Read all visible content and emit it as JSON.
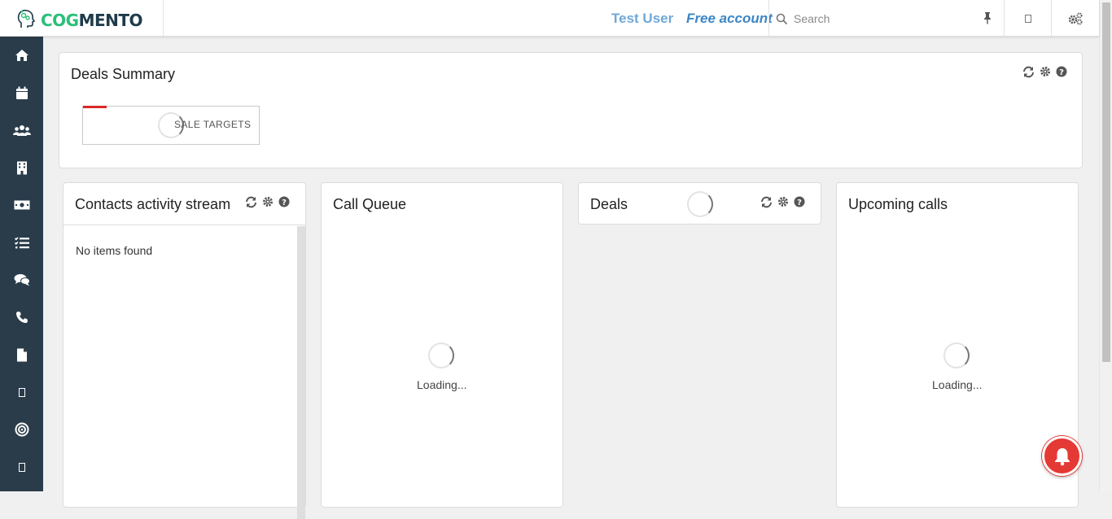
{
  "header": {
    "logo": {
      "part1": "COG",
      "part2": "MENTO"
    },
    "user_name": "Test User",
    "account_type": "Free account",
    "search": {
      "placeholder": "Search",
      "value": ""
    },
    "icons": [
      "search-icon",
      "pin-icon",
      "settings-icon"
    ]
  },
  "sidebar": {
    "items": [
      {
        "name": "home",
        "icon": "home-icon"
      },
      {
        "name": "calendar",
        "icon": "calendar-icon"
      },
      {
        "name": "contacts",
        "icon": "users-icon"
      },
      {
        "name": "companies",
        "icon": "building-icon"
      },
      {
        "name": "deals",
        "icon": "money-icon"
      },
      {
        "name": "tasks",
        "icon": "tasks-icon"
      },
      {
        "name": "cases",
        "icon": "chat-icon"
      },
      {
        "name": "calls",
        "icon": "phone-icon"
      },
      {
        "name": "documents",
        "icon": "document-icon"
      },
      {
        "name": "unknown-1",
        "icon": "box-icon"
      },
      {
        "name": "campaigns",
        "icon": "target-icon"
      },
      {
        "name": "unknown-2",
        "icon": "box-icon"
      }
    ]
  },
  "deals_summary": {
    "title": "Deals Summary",
    "sale_targets_label": "SALE TARGETS"
  },
  "contacts_activity": {
    "title": "Contacts activity stream",
    "empty_text": "No items found"
  },
  "call_queue": {
    "title": "Call Queue",
    "loading_text": "Loading..."
  },
  "deals": {
    "title": "Deals"
  },
  "upcoming_calls": {
    "title": "Upcoming calls",
    "loading_text": "Loading..."
  },
  "colors": {
    "sidebar_bg": "#2a3c4a",
    "brand_green": "#2bbf7a",
    "brand_dark": "#1e3b4a",
    "user_name": "#6ea8d8",
    "account_type": "#3d86c6",
    "accent_red": "#db2828",
    "notification_red": "#e53935"
  }
}
